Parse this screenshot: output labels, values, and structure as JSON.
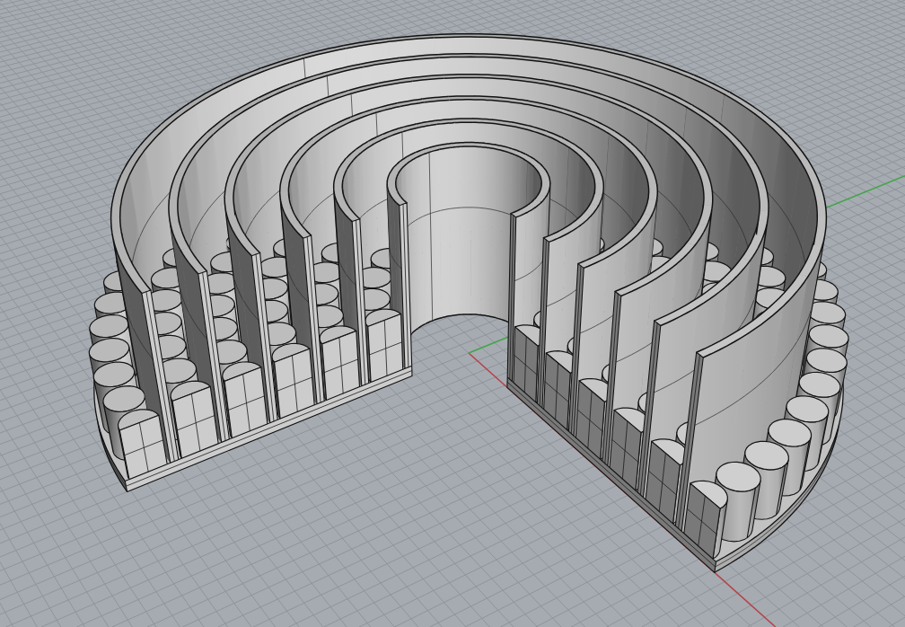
{
  "viewport": {
    "grid": true,
    "x_axis": true,
    "y_axis": true
  }
}
